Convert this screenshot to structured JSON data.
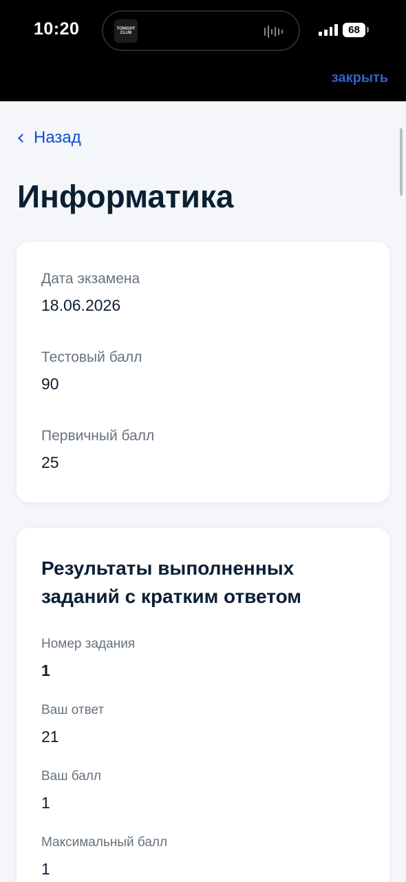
{
  "status_bar": {
    "time": "10:20",
    "island_app_label": "TONIGHT CLUB",
    "battery": "68"
  },
  "header": {
    "close_label": "закрыть",
    "close_color": "#2f63c9"
  },
  "nav": {
    "back_label": "Назад",
    "back_icon": "chevron-left-icon",
    "accent_color": "#0d4cd3"
  },
  "page": {
    "title": "Информатика"
  },
  "summary": {
    "exam_date_label": "Дата экзамена",
    "exam_date_value": "18.06.2026",
    "test_score_label": "Тестовый балл",
    "test_score_value": "90",
    "primary_score_label": "Первичный балл",
    "primary_score_value": "25"
  },
  "results": {
    "title": "Результаты выполненных заданий с кратким ответом",
    "items": [
      {
        "task_number_label": "Номер задания",
        "task_number_value": "1",
        "answer_label": "Ваш ответ",
        "answer_value": "21",
        "score_label": "Ваш балл",
        "score_value": "1",
        "max_score_label": "Максимальный балл",
        "max_score_value": "1"
      }
    ]
  }
}
